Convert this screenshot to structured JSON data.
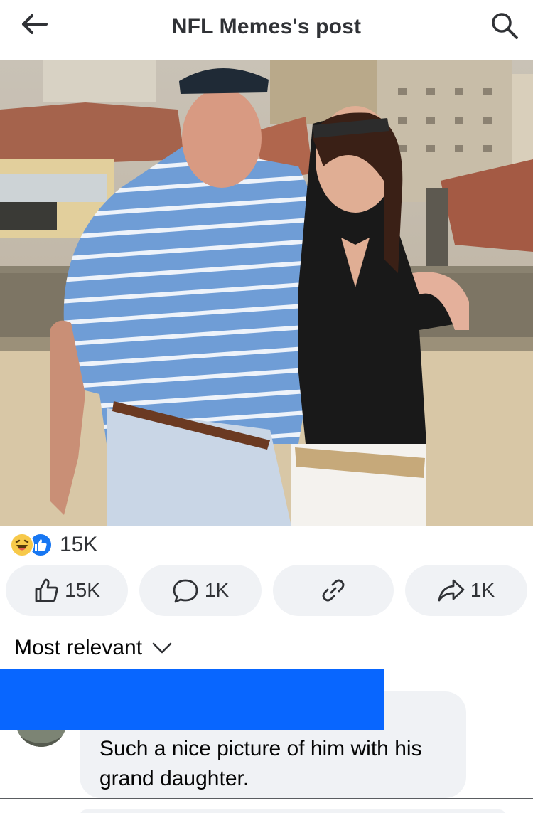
{
  "header": {
    "title": "NFL Memes's post",
    "back_icon": "arrow-left-icon",
    "search_icon": "search-icon"
  },
  "post": {
    "image_description_icon": "photo"
  },
  "reactions": {
    "types": [
      "haha",
      "like"
    ],
    "count": "15K"
  },
  "actions": {
    "like": {
      "label": "15K",
      "icon": "thumbs-up-icon"
    },
    "comment": {
      "label": "1K",
      "icon": "comment-icon"
    },
    "link": {
      "label": "",
      "icon": "link-icon"
    },
    "share": {
      "label": "1K",
      "icon": "share-icon"
    }
  },
  "comments": {
    "sort_label": "Most relevant",
    "items": [
      {
        "text": "Such a nice picture of him with his grand daughter."
      }
    ]
  },
  "colors": {
    "accent": "#1877f2",
    "redaction": "#0866ff",
    "button_bg": "#f0f2f5"
  }
}
